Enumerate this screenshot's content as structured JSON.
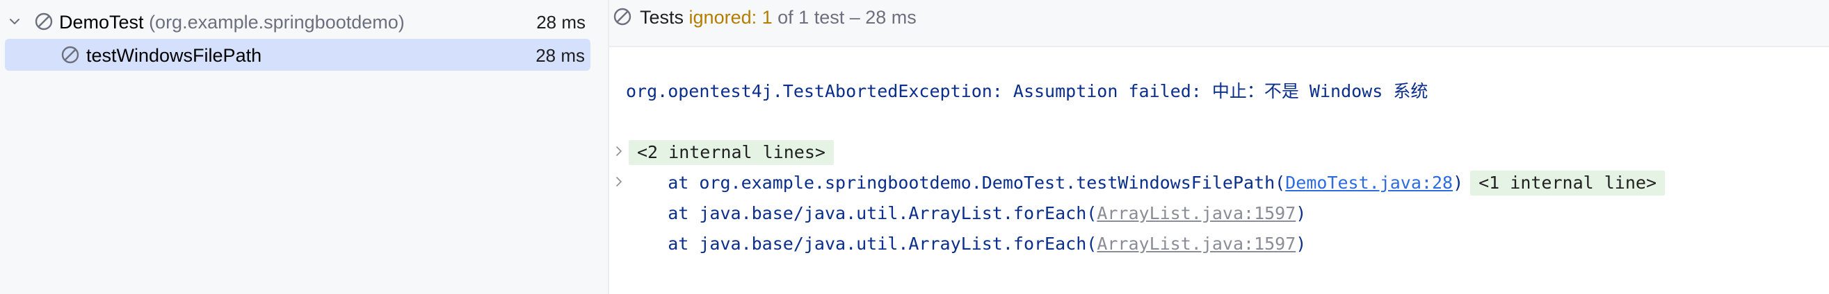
{
  "tree": {
    "root": {
      "name": "DemoTest",
      "package": "(org.example.springbootdemo)",
      "duration": "28 ms"
    },
    "child": {
      "name": "testWindowsFilePath",
      "duration": "28 ms"
    }
  },
  "status": {
    "prefix": "Tests",
    "ignored": "ignored: 1",
    "rest": "of 1 test – 28 ms"
  },
  "console": {
    "exception": "org.opentest4j.TestAbortedException: Assumption failed: 中止：不是 Windows 系统",
    "internal_lines_1": "<2 internal lines>",
    "trace1": {
      "prefix": "    at org.example.springbootdemo.DemoTest.testWindowsFilePath(",
      "link": "DemoTest.java:28",
      "suffix": ")",
      "internal": "<1 internal line>"
    },
    "trace2": {
      "prefix": "    at java.base/java.util.ArrayList.forEach(",
      "link": "ArrayList.java:1597",
      "suffix": ")"
    },
    "trace3": {
      "prefix": "    at java.base/java.util.ArrayList.forEach(",
      "link": "ArrayList.java:1597",
      "suffix": ")"
    }
  },
  "colors": {
    "selection": "#d5e1fc",
    "ignored_text": "#b27d00",
    "trace_text": "#0a2e8b",
    "link": "#2c6be0",
    "internal_bg": "#e5f3e4"
  }
}
